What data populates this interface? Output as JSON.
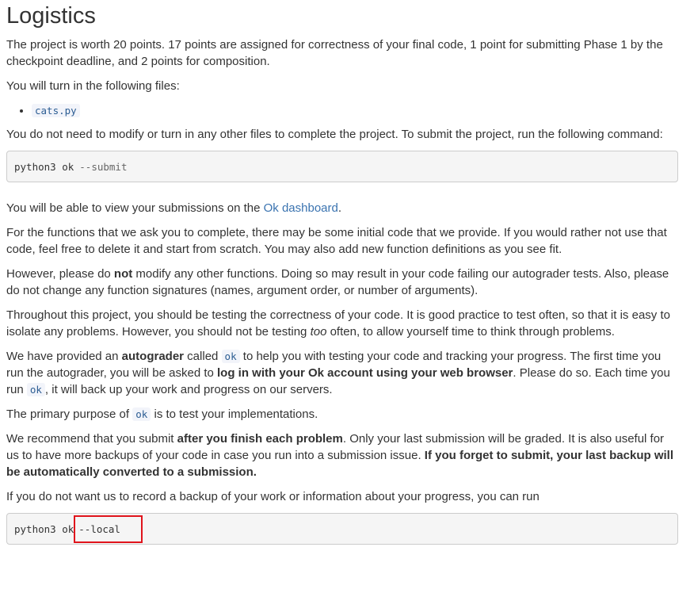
{
  "heading": "Logistics",
  "p1": "The project is worth 20 points. 17 points are assigned for correctness of your final code, 1 point for submitting Phase 1 by the checkpoint deadline, and 2 points for composition.",
  "p2": "You will turn in the following files:",
  "files": [
    "cats.py"
  ],
  "p3": "You do not need to modify or turn in any other files to complete the project. To submit the project, run the following command:",
  "cmd1": {
    "base": "python3 ok",
    "flag": "--submit"
  },
  "p4": {
    "before": "You will be able to view your submissions on the ",
    "link": "Ok dashboard",
    "after": "."
  },
  "p5": "For the functions that we ask you to complete, there may be some initial code that we provide. If you would rather not use that code, feel free to delete it and start from scratch. You may also add new function definitions as you see fit.",
  "p6": {
    "before": "However, please do ",
    "bold": "not",
    "after": " modify any other functions. Doing so may result in your code failing our autograder tests. Also, please do not change any function signatures (names, argument order, or number of arguments)."
  },
  "p7": {
    "before": "Throughout this project, you should be testing the correctness of your code. It is good practice to test often, so that it is easy to isolate any problems. However, you should not be testing ",
    "em": "too",
    "after": " often, to allow yourself time to think through problems."
  },
  "p8": {
    "t1": "We have provided an ",
    "b1": "autograder",
    "t2": " called ",
    "c1": "ok",
    "t3": " to help you with testing your code and tracking your progress. The first time you run the autograder, you will be asked to ",
    "b2": "log in with your Ok account using your web browser",
    "t4": ". Please do so. Each time you run ",
    "c2": "ok",
    "t5": ", it will back up your work and progress on our servers."
  },
  "p9": {
    "before": "The primary purpose of ",
    "code": "ok",
    "after": " is to test your implementations."
  },
  "p10": {
    "t1": "We recommend that you submit ",
    "b1": "after you finish each problem",
    "t2": ". Only your last submission will be graded. It is also useful for us to have more backups of your code in case you run into a submission issue. ",
    "b2": "If you forget to submit, your last backup will be automatically converted to a submission."
  },
  "p11": "If you do not want us to record a backup of your work or information about your progress, you can run",
  "cmd2": {
    "base": "python3 ok",
    "flag": "--local"
  },
  "colors": {
    "highlight_border": "#e0141c",
    "link": "#3a73b0",
    "code_text": "#2c5d93"
  }
}
